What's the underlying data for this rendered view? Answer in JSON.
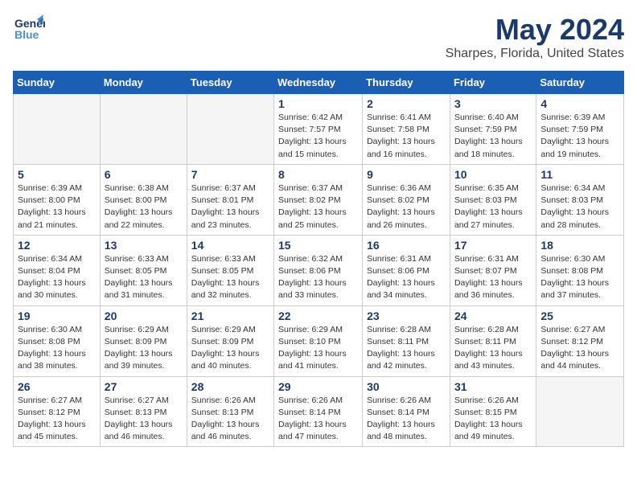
{
  "logo": {
    "line1": "General",
    "line2": "Blue"
  },
  "title": "May 2024",
  "subtitle": "Sharpes, Florida, United States",
  "weekdays": [
    "Sunday",
    "Monday",
    "Tuesday",
    "Wednesday",
    "Thursday",
    "Friday",
    "Saturday"
  ],
  "weeks": [
    [
      {
        "day": "",
        "empty": true
      },
      {
        "day": "",
        "empty": true
      },
      {
        "day": "",
        "empty": true
      },
      {
        "day": "1",
        "sunrise": "Sunrise: 6:42 AM",
        "sunset": "Sunset: 7:57 PM",
        "daylight": "Daylight: 13 hours and 15 minutes."
      },
      {
        "day": "2",
        "sunrise": "Sunrise: 6:41 AM",
        "sunset": "Sunset: 7:58 PM",
        "daylight": "Daylight: 13 hours and 16 minutes."
      },
      {
        "day": "3",
        "sunrise": "Sunrise: 6:40 AM",
        "sunset": "Sunset: 7:59 PM",
        "daylight": "Daylight: 13 hours and 18 minutes."
      },
      {
        "day": "4",
        "sunrise": "Sunrise: 6:39 AM",
        "sunset": "Sunset: 7:59 PM",
        "daylight": "Daylight: 13 hours and 19 minutes."
      }
    ],
    [
      {
        "day": "5",
        "sunrise": "Sunrise: 6:39 AM",
        "sunset": "Sunset: 8:00 PM",
        "daylight": "Daylight: 13 hours and 21 minutes."
      },
      {
        "day": "6",
        "sunrise": "Sunrise: 6:38 AM",
        "sunset": "Sunset: 8:00 PM",
        "daylight": "Daylight: 13 hours and 22 minutes."
      },
      {
        "day": "7",
        "sunrise": "Sunrise: 6:37 AM",
        "sunset": "Sunset: 8:01 PM",
        "daylight": "Daylight: 13 hours and 23 minutes."
      },
      {
        "day": "8",
        "sunrise": "Sunrise: 6:37 AM",
        "sunset": "Sunset: 8:02 PM",
        "daylight": "Daylight: 13 hours and 25 minutes."
      },
      {
        "day": "9",
        "sunrise": "Sunrise: 6:36 AM",
        "sunset": "Sunset: 8:02 PM",
        "daylight": "Daylight: 13 hours and 26 minutes."
      },
      {
        "day": "10",
        "sunrise": "Sunrise: 6:35 AM",
        "sunset": "Sunset: 8:03 PM",
        "daylight": "Daylight: 13 hours and 27 minutes."
      },
      {
        "day": "11",
        "sunrise": "Sunrise: 6:34 AM",
        "sunset": "Sunset: 8:03 PM",
        "daylight": "Daylight: 13 hours and 28 minutes."
      }
    ],
    [
      {
        "day": "12",
        "sunrise": "Sunrise: 6:34 AM",
        "sunset": "Sunset: 8:04 PM",
        "daylight": "Daylight: 13 hours and 30 minutes."
      },
      {
        "day": "13",
        "sunrise": "Sunrise: 6:33 AM",
        "sunset": "Sunset: 8:05 PM",
        "daylight": "Daylight: 13 hours and 31 minutes."
      },
      {
        "day": "14",
        "sunrise": "Sunrise: 6:33 AM",
        "sunset": "Sunset: 8:05 PM",
        "daylight": "Daylight: 13 hours and 32 minutes."
      },
      {
        "day": "15",
        "sunrise": "Sunrise: 6:32 AM",
        "sunset": "Sunset: 8:06 PM",
        "daylight": "Daylight: 13 hours and 33 minutes."
      },
      {
        "day": "16",
        "sunrise": "Sunrise: 6:31 AM",
        "sunset": "Sunset: 8:06 PM",
        "daylight": "Daylight: 13 hours and 34 minutes."
      },
      {
        "day": "17",
        "sunrise": "Sunrise: 6:31 AM",
        "sunset": "Sunset: 8:07 PM",
        "daylight": "Daylight: 13 hours and 36 minutes."
      },
      {
        "day": "18",
        "sunrise": "Sunrise: 6:30 AM",
        "sunset": "Sunset: 8:08 PM",
        "daylight": "Daylight: 13 hours and 37 minutes."
      }
    ],
    [
      {
        "day": "19",
        "sunrise": "Sunrise: 6:30 AM",
        "sunset": "Sunset: 8:08 PM",
        "daylight": "Daylight: 13 hours and 38 minutes."
      },
      {
        "day": "20",
        "sunrise": "Sunrise: 6:29 AM",
        "sunset": "Sunset: 8:09 PM",
        "daylight": "Daylight: 13 hours and 39 minutes."
      },
      {
        "day": "21",
        "sunrise": "Sunrise: 6:29 AM",
        "sunset": "Sunset: 8:09 PM",
        "daylight": "Daylight: 13 hours and 40 minutes."
      },
      {
        "day": "22",
        "sunrise": "Sunrise: 6:29 AM",
        "sunset": "Sunset: 8:10 PM",
        "daylight": "Daylight: 13 hours and 41 minutes."
      },
      {
        "day": "23",
        "sunrise": "Sunrise: 6:28 AM",
        "sunset": "Sunset: 8:11 PM",
        "daylight": "Daylight: 13 hours and 42 minutes."
      },
      {
        "day": "24",
        "sunrise": "Sunrise: 6:28 AM",
        "sunset": "Sunset: 8:11 PM",
        "daylight": "Daylight: 13 hours and 43 minutes."
      },
      {
        "day": "25",
        "sunrise": "Sunrise: 6:27 AM",
        "sunset": "Sunset: 8:12 PM",
        "daylight": "Daylight: 13 hours and 44 minutes."
      }
    ],
    [
      {
        "day": "26",
        "sunrise": "Sunrise: 6:27 AM",
        "sunset": "Sunset: 8:12 PM",
        "daylight": "Daylight: 13 hours and 45 minutes."
      },
      {
        "day": "27",
        "sunrise": "Sunrise: 6:27 AM",
        "sunset": "Sunset: 8:13 PM",
        "daylight": "Daylight: 13 hours and 46 minutes."
      },
      {
        "day": "28",
        "sunrise": "Sunrise: 6:26 AM",
        "sunset": "Sunset: 8:13 PM",
        "daylight": "Daylight: 13 hours and 46 minutes."
      },
      {
        "day": "29",
        "sunrise": "Sunrise: 6:26 AM",
        "sunset": "Sunset: 8:14 PM",
        "daylight": "Daylight: 13 hours and 47 minutes."
      },
      {
        "day": "30",
        "sunrise": "Sunrise: 6:26 AM",
        "sunset": "Sunset: 8:14 PM",
        "daylight": "Daylight: 13 hours and 48 minutes."
      },
      {
        "day": "31",
        "sunrise": "Sunrise: 6:26 AM",
        "sunset": "Sunset: 8:15 PM",
        "daylight": "Daylight: 13 hours and 49 minutes."
      },
      {
        "day": "",
        "empty": true
      }
    ]
  ]
}
